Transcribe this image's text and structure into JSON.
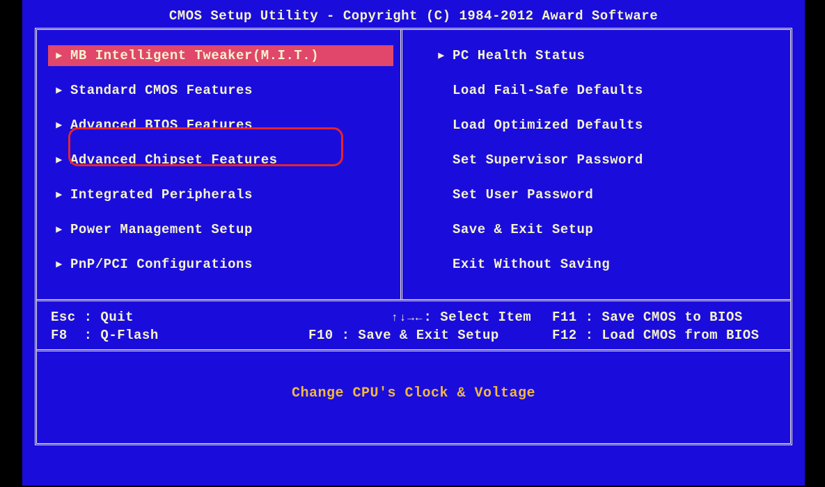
{
  "title": "CMOS Setup Utility - Copyright (C) 1984-2012 Award Software",
  "menu": {
    "left": [
      {
        "label": "MB Intelligent Tweaker(M.I.T.)",
        "arrow": true,
        "selected": true
      },
      {
        "label": "Standard CMOS Features",
        "arrow": true,
        "selected": false
      },
      {
        "label": "Advanced BIOS Features",
        "arrow": true,
        "selected": false
      },
      {
        "label": "Advanced Chipset Features",
        "arrow": true,
        "selected": false
      },
      {
        "label": "Integrated Peripherals",
        "arrow": true,
        "selected": false
      },
      {
        "label": "Power Management Setup",
        "arrow": true,
        "selected": false
      },
      {
        "label": "PnP/PCI Configurations",
        "arrow": true,
        "selected": false
      }
    ],
    "right": [
      {
        "label": "PC Health Status",
        "arrow": true
      },
      {
        "label": "Load Fail-Safe Defaults",
        "arrow": false
      },
      {
        "label": "Load Optimized Defaults",
        "arrow": false
      },
      {
        "label": "Set Supervisor Password",
        "arrow": false
      },
      {
        "label": "Set User Password",
        "arrow": false
      },
      {
        "label": "Save & Exit Setup",
        "arrow": false
      },
      {
        "label": "Exit Without Saving",
        "arrow": false
      }
    ]
  },
  "footer": {
    "row1": {
      "left": "Esc : Quit",
      "mid": "↑↓→←: Select Item",
      "right": "F11 : Save CMOS to BIOS"
    },
    "row2": {
      "left": "F8  : Q-Flash",
      "mid": "F10 : Save & Exit Setup",
      "right": "F12 : Load CMOS from BIOS"
    }
  },
  "help_text": "Change CPU's Clock & Voltage",
  "annotation": {
    "circled_item_index": 2
  }
}
